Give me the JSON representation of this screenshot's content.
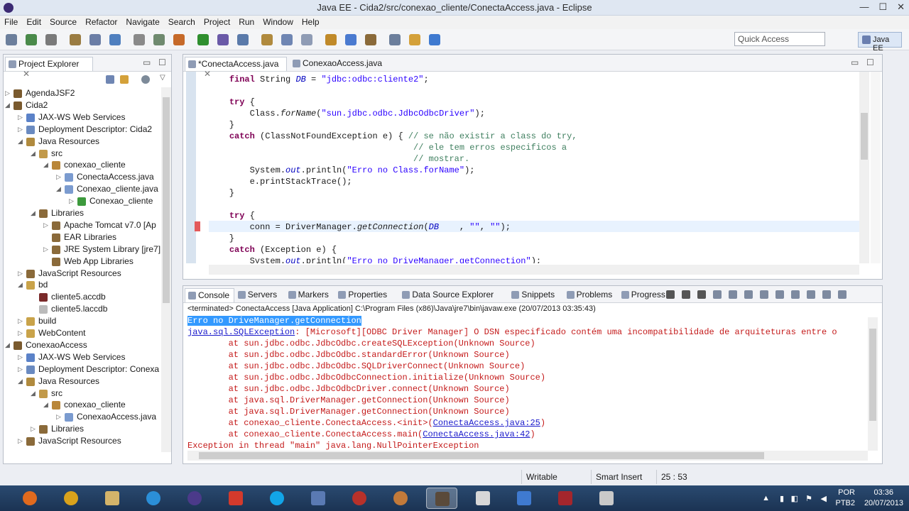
{
  "window": {
    "title": "Java EE - Cida2/src/conexao_cliente/ConectaAccess.java - Eclipse",
    "minimize": "—",
    "maximize": "☐",
    "close": "✕"
  },
  "menu": [
    "File",
    "Edit",
    "Source",
    "Refactor",
    "Navigate",
    "Search",
    "Project",
    "Run",
    "Window",
    "Help"
  ],
  "toolbar": {
    "quick_access_placeholder": "Quick Access",
    "perspective": "Java EE"
  },
  "explorer": {
    "title": "Project Explorer",
    "items": [
      {
        "label": "AgendaJSF2",
        "indent": 1,
        "tw": "▷",
        "icon": "#7a5a2e"
      },
      {
        "label": "Cida2",
        "indent": 1,
        "tw": "◢",
        "icon": "#7a5a2e"
      },
      {
        "label": "JAX-WS Web Services",
        "indent": 2,
        "tw": "▷",
        "icon": "#5b82c8"
      },
      {
        "label": "Deployment Descriptor: Cida2",
        "indent": 2,
        "tw": "▷",
        "icon": "#6a8ac0"
      },
      {
        "label": "Java Resources",
        "indent": 2,
        "tw": "◢",
        "icon": "#b08a3e"
      },
      {
        "label": "src",
        "indent": 3,
        "tw": "◢",
        "icon": "#c29a4a"
      },
      {
        "label": "conexao_cliente",
        "indent": 4,
        "tw": "◢",
        "icon": "#b9873a"
      },
      {
        "label": "ConectaAccess.java",
        "indent": 5,
        "tw": "▷",
        "icon": "#7b9bcf"
      },
      {
        "label": "Conexao_cliente.java",
        "indent": 5,
        "tw": "◢",
        "icon": "#7b9bcf"
      },
      {
        "label": "Conexao_cliente",
        "indent": 6,
        "tw": "▷",
        "icon": "#3d9a3d"
      },
      {
        "label": "Libraries",
        "indent": 3,
        "tw": "◢",
        "icon": "#8a6a3a"
      },
      {
        "label": "Apache Tomcat v7.0 [Ap",
        "indent": 4,
        "tw": "▷",
        "icon": "#8a6a3a"
      },
      {
        "label": "EAR Libraries",
        "indent": 4,
        "tw": "",
        "icon": "#8a6a3a"
      },
      {
        "label": "JRE System Library [jre7]",
        "indent": 4,
        "tw": "▷",
        "icon": "#8a6a3a"
      },
      {
        "label": "Web App Libraries",
        "indent": 4,
        "tw": "",
        "icon": "#8a6a3a"
      },
      {
        "label": "JavaScript Resources",
        "indent": 2,
        "tw": "▷",
        "icon": "#8a6a3a"
      },
      {
        "label": "bd",
        "indent": 2,
        "tw": "◢",
        "icon": "#c9a34a"
      },
      {
        "label": "cliente5.accdb",
        "indent": 3,
        "tw": "",
        "icon": "#7a2a2a"
      },
      {
        "label": "cliente5.laccdb",
        "indent": 3,
        "tw": "",
        "icon": "#bbbbbb"
      },
      {
        "label": "build",
        "indent": 2,
        "tw": "▷",
        "icon": "#c9a34a"
      },
      {
        "label": "WebContent",
        "indent": 2,
        "tw": "▷",
        "icon": "#c9a34a"
      },
      {
        "label": "ConexaoAccess",
        "indent": 1,
        "tw": "◢",
        "icon": "#7a5a2e"
      },
      {
        "label": "JAX-WS Web Services",
        "indent": 2,
        "tw": "▷",
        "icon": "#5b82c8"
      },
      {
        "label": "Deployment Descriptor: Conexa",
        "indent": 2,
        "tw": "▷",
        "icon": "#6a8ac0"
      },
      {
        "label": "Java Resources",
        "indent": 2,
        "tw": "◢",
        "icon": "#b08a3e"
      },
      {
        "label": "src",
        "indent": 3,
        "tw": "◢",
        "icon": "#c29a4a"
      },
      {
        "label": "conexao_cliente",
        "indent": 4,
        "tw": "◢",
        "icon": "#b9873a"
      },
      {
        "label": "ConexaoAccess.java",
        "indent": 5,
        "tw": "▷",
        "icon": "#7b9bcf"
      },
      {
        "label": "Libraries",
        "indent": 3,
        "tw": "▷",
        "icon": "#8a6a3a"
      },
      {
        "label": "JavaScript Resources",
        "indent": 2,
        "tw": "▷",
        "icon": "#8a6a3a"
      }
    ]
  },
  "editor": {
    "tabs": [
      "*ConectaAccess.java",
      "ConexaoAccess.java"
    ],
    "lines": [
      [
        {
          "t": "    "
        },
        {
          "t": "final",
          "c": "kw"
        },
        {
          "t": " String "
        },
        {
          "t": "DB",
          "c": "fld"
        },
        {
          "t": " = "
        },
        {
          "t": "\"jdbc:odbc:cliente2\"",
          "c": "str"
        },
        {
          "t": ";"
        }
      ],
      [],
      [
        {
          "t": "    "
        },
        {
          "t": "try",
          "c": "kw"
        },
        {
          "t": " {"
        }
      ],
      [
        {
          "t": "        Class."
        },
        {
          "t": "forName",
          "c": "it"
        },
        {
          "t": "("
        },
        {
          "t": "\"sun.jdbc.odbc.JdbcOdbcDriver\"",
          "c": "str"
        },
        {
          "t": ");"
        }
      ],
      [
        {
          "t": "    }"
        }
      ],
      [
        {
          "t": "    "
        },
        {
          "t": "catch",
          "c": "kw"
        },
        {
          "t": " (ClassNotFoundException e) { "
        },
        {
          "t": "// se não existir a class do try,",
          "c": "cm"
        }
      ],
      [
        {
          "t": "                                        "
        },
        {
          "t": "// ele tem erros especificos a",
          "c": "cm"
        }
      ],
      [
        {
          "t": "                                        "
        },
        {
          "t": "// mostrar.",
          "c": "cm"
        }
      ],
      [
        {
          "t": "        System."
        },
        {
          "t": "out",
          "c": "fld"
        },
        {
          "t": ".println("
        },
        {
          "t": "\"Erro no Class.forName\"",
          "c": "str"
        },
        {
          "t": ");"
        }
      ],
      [
        {
          "t": "        e.printStackTrace();"
        }
      ],
      [
        {
          "t": "    }"
        }
      ],
      [],
      [
        {
          "t": "    "
        },
        {
          "t": "try",
          "c": "kw"
        },
        {
          "t": " {"
        }
      ],
      [
        {
          "t": "        conn = DriverManager."
        },
        {
          "t": "getConnection",
          "c": "it"
        },
        {
          "t": "("
        },
        {
          "t": "DB",
          "c": "fld"
        },
        {
          "t": "    , "
        },
        {
          "t": "\"\"",
          "c": "str"
        },
        {
          "t": ", "
        },
        {
          "t": "\"\"",
          "c": "str"
        },
        {
          "t": ");"
        }
      ],
      [
        {
          "t": "    }"
        }
      ],
      [
        {
          "t": "    "
        },
        {
          "t": "catch",
          "c": "kw"
        },
        {
          "t": " (Exception e) {"
        }
      ],
      [
        {
          "t": "        System."
        },
        {
          "t": "out",
          "c": "fld"
        },
        {
          "t": ".println("
        },
        {
          "t": "\"Erro no DriveManager.getConnection\"",
          "c": "str"
        },
        {
          "t": ");"
        }
      ]
    ]
  },
  "console": {
    "tabs": [
      "Console",
      "Servers",
      "Markers",
      "Properties",
      "Data Source Explorer",
      "Snippets",
      "Problems",
      "Progress"
    ],
    "header": "<terminated> ConectaAccess [Java Application] C:\\Program Files (x86)\\Java\\jre7\\bin\\javaw.exe (20/07/2013 03:35:43)",
    "lines": [
      [
        {
          "t": "Erro no DriveManager.getConnection",
          "c": "sel"
        }
      ],
      [
        {
          "t": "java.sql.SQLException",
          "c": "link"
        },
        {
          "t": ": [Microsoft][ODBC Driver Manager] O DSN especificado contém uma incompatibilidade de arquiteturas entre o",
          "c": "red"
        }
      ],
      [
        {
          "t": "\tat sun.jdbc.odbc.JdbcOdbc.createSQLException(Unknown Source)",
          "c": "red"
        }
      ],
      [
        {
          "t": "\tat sun.jdbc.odbc.JdbcOdbc.standardError(Unknown Source)",
          "c": "red"
        }
      ],
      [
        {
          "t": "\tat sun.jdbc.odbc.JdbcOdbc.SQLDriverConnect(Unknown Source)",
          "c": "red"
        }
      ],
      [
        {
          "t": "\tat sun.jdbc.odbc.JdbcOdbcConnection.initialize(Unknown Source)",
          "c": "red"
        }
      ],
      [
        {
          "t": "\tat sun.jdbc.odbc.JdbcOdbcDriver.connect(Unknown Source)",
          "c": "red"
        }
      ],
      [
        {
          "t": "\tat java.sql.DriverManager.getConnection(Unknown Source)",
          "c": "red"
        }
      ],
      [
        {
          "t": "\tat java.sql.DriverManager.getConnection(Unknown Source)",
          "c": "red"
        }
      ],
      [
        {
          "t": "\tat conexao_cliente.ConectaAccess.<init>(",
          "c": "red"
        },
        {
          "t": "ConectaAccess.java:25",
          "c": "link"
        },
        {
          "t": ")",
          "c": "red"
        }
      ],
      [
        {
          "t": "\tat conexao_cliente.ConectaAccess.main(",
          "c": "red"
        },
        {
          "t": "ConectaAccess.java:42",
          "c": "link"
        },
        {
          "t": ")",
          "c": "red"
        }
      ],
      [
        {
          "t": "Exception in thread \"main\" java.lang.NullPointerException",
          "c": "red"
        }
      ]
    ]
  },
  "status": {
    "writable": "Writable",
    "insert": "Smart Insert",
    "position": "25 : 53"
  },
  "tray": {
    "lang1": "POR",
    "lang2": "PTB2",
    "time": "03:36",
    "date": "20/07/2013"
  }
}
